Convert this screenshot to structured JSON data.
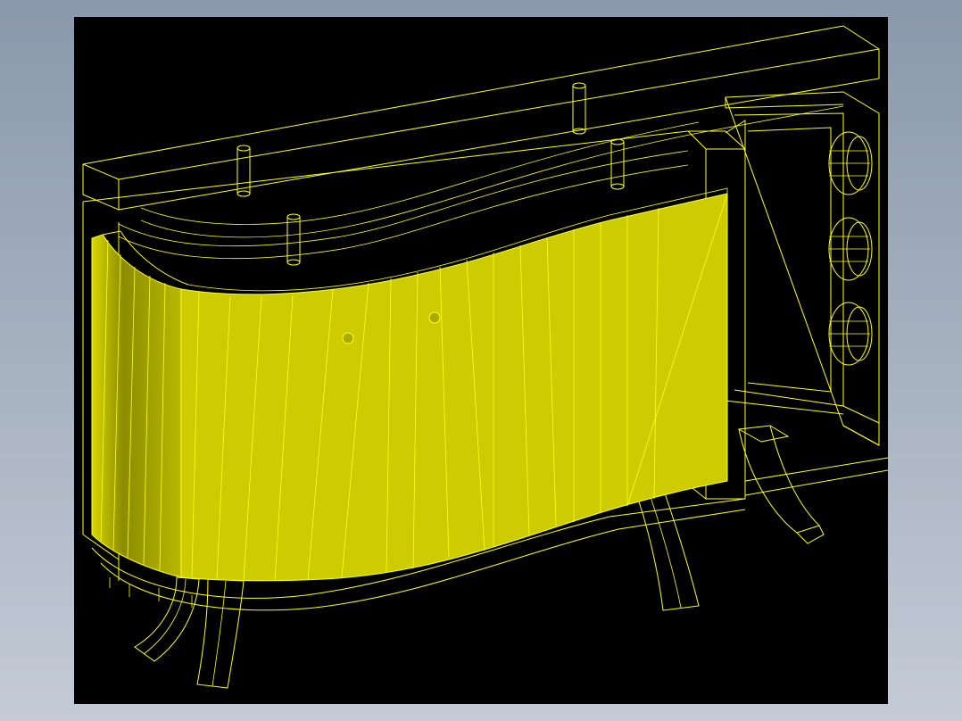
{
  "viewer": {
    "background_color": "#000000",
    "frame_gradient": [
      "#8a98ab",
      "#c4cbd6"
    ]
  },
  "model": {
    "render_style": "wireframe-with-shaded-door",
    "wire_color": "#ffff1a",
    "door_color": "#cccc00",
    "door_dark_color": "#888800",
    "dowel_count": 4,
    "knob_count": 3,
    "leg_count": 4
  }
}
